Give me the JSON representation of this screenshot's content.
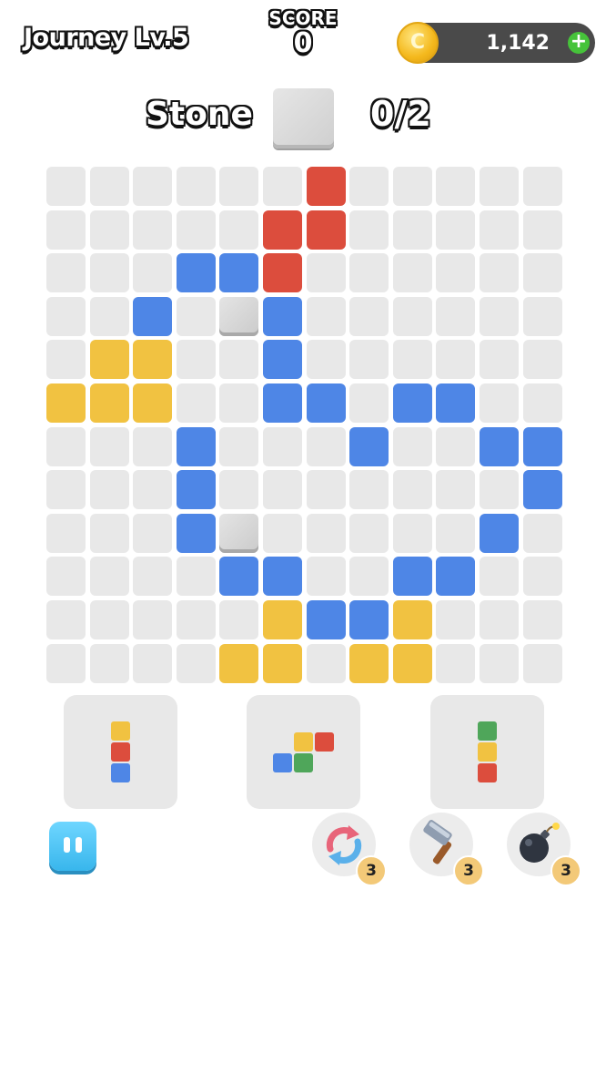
{
  "header": {
    "level_title": "Journey Lv.5",
    "score_label": "SCORE",
    "score_value": "0",
    "coins": "1,142",
    "coin_glyph": "C",
    "add_glyph": "+"
  },
  "goal": {
    "label": "Stone",
    "progress": "0/2",
    "collected": 0,
    "target": 2
  },
  "colors": {
    "red": "#dc4d3d",
    "blue": "#4e86e6",
    "yellow": "#f1c241",
    "green": "#4fa65a",
    "empty": "#e8e8e8",
    "pause": "#38b6ec"
  },
  "board": {
    "rows": [
      "......R.....",
      ".....RR.....",
      "...BBR......",
      "..B.SB......",
      ".YY..B......",
      "YYY..BB.BB..",
      "...B...B..BB",
      "...B.......B",
      "...BS.....B.",
      "....BB..BB..",
      ".....YBBY...",
      "....YY.YY..."
    ]
  },
  "trays": [
    {
      "piece": [
        [
          "yellow",
          0,
          0
        ],
        [
          "red",
          0,
          1
        ],
        [
          "blue",
          0,
          2
        ]
      ]
    },
    {
      "piece": [
        [
          "yellow",
          1,
          0
        ],
        [
          "red",
          2,
          0
        ],
        [
          "blue",
          0,
          1
        ],
        [
          "green",
          1,
          1
        ]
      ]
    },
    {
      "piece": [
        [
          "green",
          0,
          0
        ],
        [
          "yellow",
          0,
          1
        ],
        [
          "red",
          0,
          2
        ]
      ]
    }
  ],
  "boosters": [
    {
      "name": "shuffle-icon",
      "count": "3"
    },
    {
      "name": "hammer-icon",
      "count": "3"
    },
    {
      "name": "bomb-icon",
      "count": "3"
    }
  ]
}
